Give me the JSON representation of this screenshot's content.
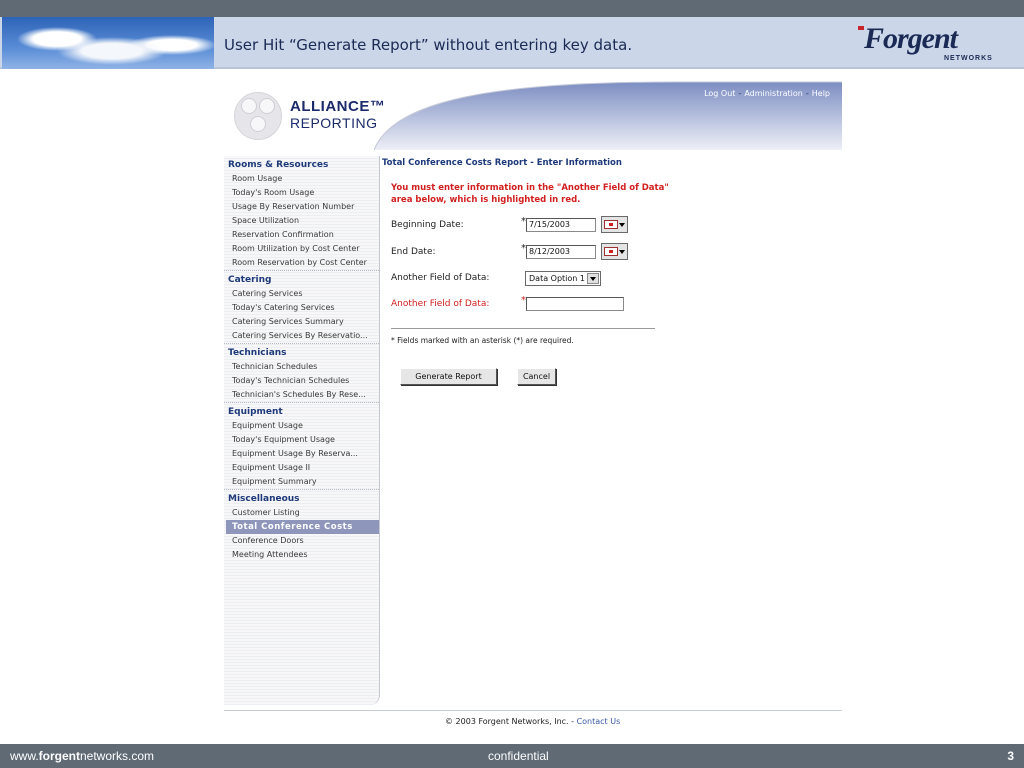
{
  "slide": {
    "title": "User Hit “Generate Report” without entering key data.",
    "brand_name": "Forgent",
    "brand_sub": "NETWORKS",
    "footer_url_prefix": "www.",
    "footer_url_bold": "forgent",
    "footer_url_suffix": "networks.com",
    "footer_confidential": "confidential",
    "page_number": "3"
  },
  "app": {
    "logo_line1": "ALLIANCE™",
    "logo_line2": "REPORTING",
    "top_links": {
      "logout": "Log Out",
      "administration": "Administration",
      "help": "Help",
      "separator": "-"
    },
    "sidebar": {
      "sections": [
        {
          "heading": "Rooms & Resources",
          "items": [
            "Room Usage",
            "Today's Room Usage",
            "Usage By Reservation Number",
            "Space Utilization",
            "Reservation Confirmation",
            "Room Utilization by Cost Center",
            "Room Reservation by Cost Center"
          ]
        },
        {
          "heading": "Catering",
          "items": [
            "Catering Services",
            "Today's Catering Services",
            "Catering Services Summary",
            "Catering Services By Reservatio..."
          ]
        },
        {
          "heading": "Technicians",
          "items": [
            "Technician Schedules",
            "Today's Technician Schedules",
            "Technician's Schedules By Rese..."
          ]
        },
        {
          "heading": "Equipment",
          "items": [
            "Equipment Usage",
            "Today's Equipment Usage",
            "Equipment Usage By Reserva...",
            "Equipment Usage II",
            "Equipment Summary"
          ]
        },
        {
          "heading": "Miscellaneous",
          "items": [
            "Customer Listing",
            "Total Conference Costs",
            "Conference Doors",
            "Meeting Attendees"
          ]
        }
      ],
      "active_item": "Total Conference Costs"
    },
    "form": {
      "title": "Total Conference Costs Report - Enter Information",
      "error_message": "You must enter information in the \"Another Field of Data\" area below, which is highlighted in red.",
      "beginning_date_label": "Beginning Date:",
      "beginning_date_value": "7/15/2003",
      "end_date_label": "End Date:",
      "end_date_value": "8/12/2003",
      "another_field_label": "Another Field of Data:",
      "another_field_select_value": "Data Option 1",
      "another_field_required_label": "Another Field of Data:",
      "another_field_required_value": "",
      "asterisk": "*",
      "required_note": "* Fields marked with an asterisk (*) are required.",
      "generate_button": "Generate Report",
      "cancel_button": "Cancel"
    },
    "copyright_text": "© 2003 Forgent Networks, Inc. -",
    "contact_link": "Contact Us"
  },
  "colors": {
    "header_bar": "#5f6a74",
    "title_band": "#cbd6e8",
    "nav_heading": "#1e3a7a",
    "error_red": "#d21f1f",
    "active_item_bg": "#8e96bc"
  }
}
